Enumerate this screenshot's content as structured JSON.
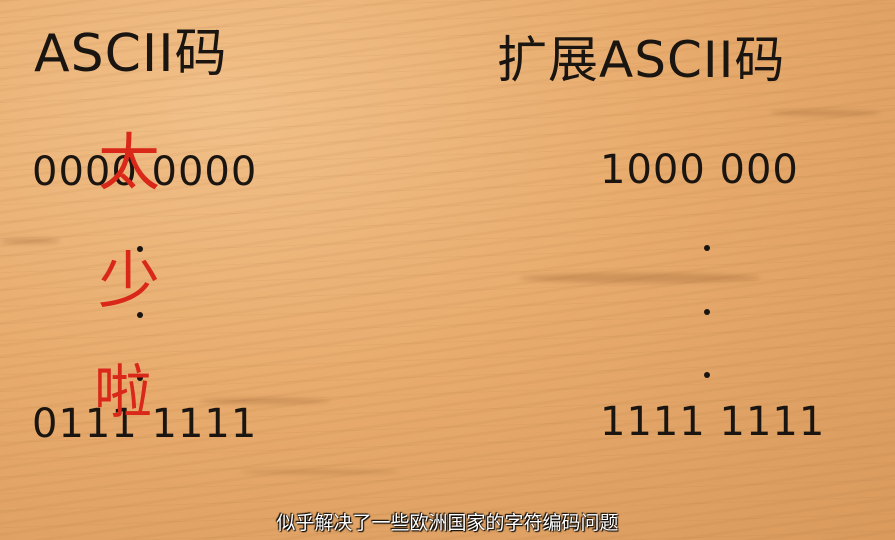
{
  "slide": {
    "left_title": "ASCII码",
    "right_title": "扩展ASCII码",
    "left_top_code": "0000 0000",
    "left_bottom_code": "0111 1111",
    "right_top_code": "1000 000",
    "right_bottom_code": "1111 1111",
    "annotation": [
      "太",
      "少",
      "啦"
    ],
    "subtitle": "似乎解决了一些欧洲国家的字符编码问题"
  },
  "colors": {
    "wood": "#e8ac6e",
    "ink": "#1a1510",
    "annotation_red": "#d9271a",
    "subtitle": "#ffffff"
  }
}
